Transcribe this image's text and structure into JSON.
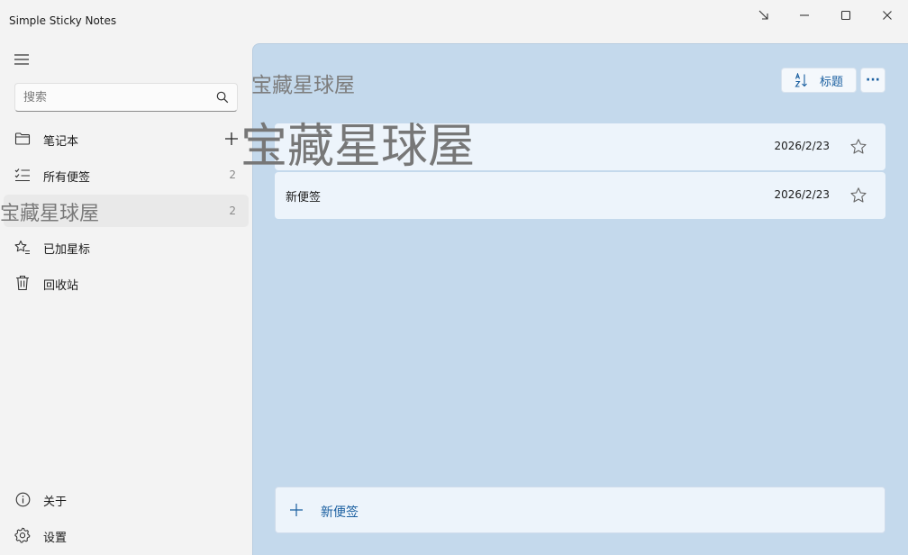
{
  "window": {
    "title": "Simple Sticky Notes"
  },
  "search": {
    "placeholder": "搜索"
  },
  "sidebar": {
    "items": [
      {
        "label": "笔记本",
        "icon": "folder-icon"
      },
      {
        "label": "所有便签",
        "icon": "checklist-icon",
        "count": "2"
      },
      {
        "label": "宝藏星球屋",
        "icon": "notebook-icon",
        "count": "2"
      },
      {
        "label": "已加星标",
        "icon": "star-list-icon"
      },
      {
        "label": "回收站",
        "icon": "trash-icon"
      }
    ],
    "bottom": [
      {
        "label": "关于",
        "icon": "info-icon"
      },
      {
        "label": "设置",
        "icon": "gear-icon"
      }
    ]
  },
  "main": {
    "title": "宝藏星球屋",
    "sort_label": "标题",
    "more_label": "···",
    "notes": [
      {
        "title": "宝藏星球屋",
        "date": "2026/2/23",
        "starred": false
      },
      {
        "title": "新便签",
        "date": "2026/2/23",
        "starred": false
      }
    ],
    "new_note_label": "新便签"
  },
  "colors": {
    "accent": "#1a5fa0",
    "main_background": "#c4d9ec",
    "card_background": "#edf4fb",
    "sidebar_background": "#f3f3f3"
  }
}
